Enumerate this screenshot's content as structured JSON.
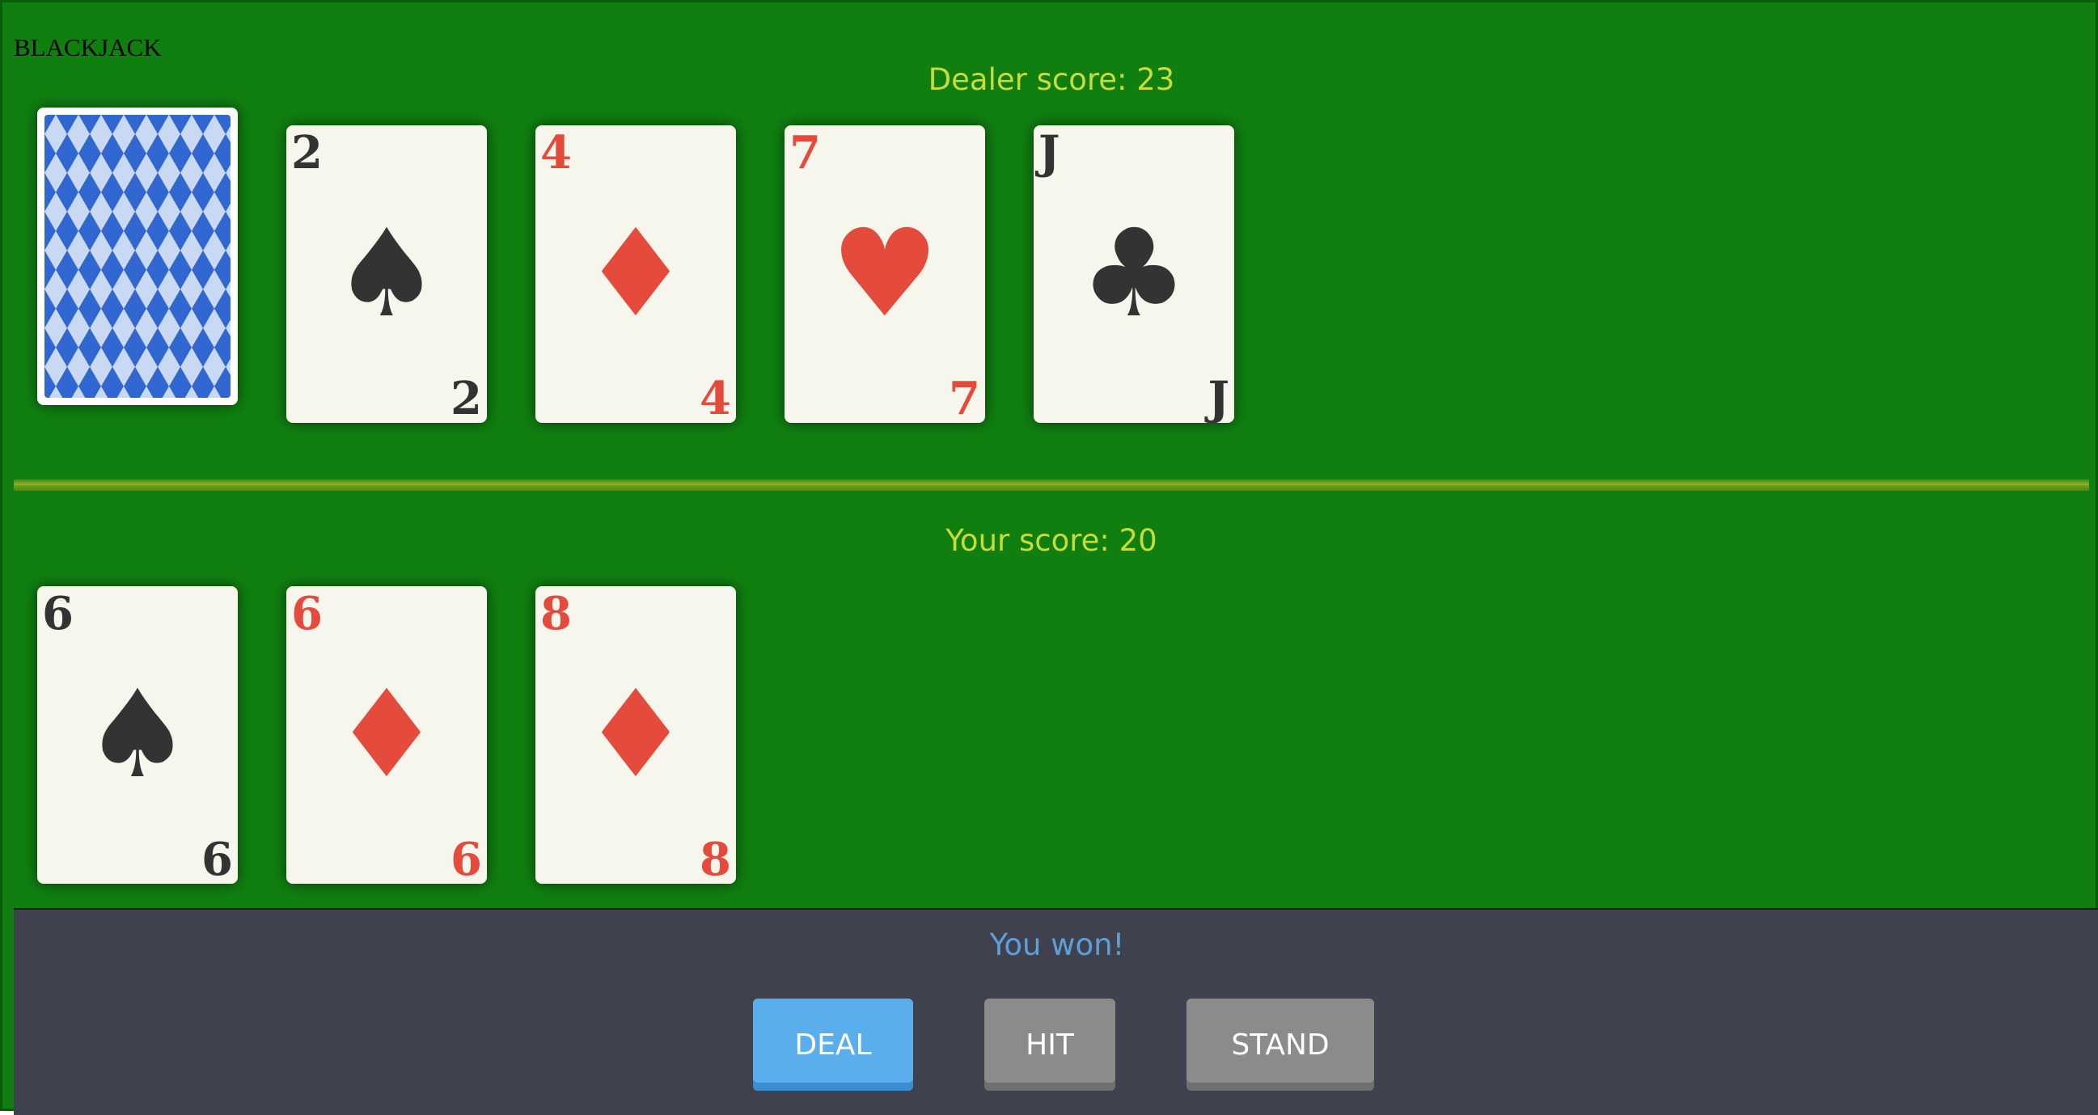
{
  "app": {
    "title": "BLACKJACK"
  },
  "dealer": {
    "score_label": "Dealer score: 23",
    "cards": [
      {
        "face_down": true
      },
      {
        "rank": "2",
        "suit": "♠",
        "color": "black"
      },
      {
        "rank": "4",
        "suit": "♦",
        "color": "red"
      },
      {
        "rank": "7",
        "suit": "♥",
        "color": "red"
      },
      {
        "rank": "J",
        "suit": "♣",
        "color": "black"
      }
    ]
  },
  "player": {
    "score_label": "Your score: 20",
    "cards": [
      {
        "rank": "6",
        "suit": "♠",
        "color": "black"
      },
      {
        "rank": "6",
        "suit": "♦",
        "color": "red"
      },
      {
        "rank": "8",
        "suit": "♦",
        "color": "red"
      }
    ]
  },
  "status": {
    "message": "You won!"
  },
  "controls": {
    "deal": "DEAL",
    "hit": "HIT",
    "stand": "STAND"
  },
  "colors": {
    "table": "#107f10",
    "score_text": "#c5dc3c",
    "red_suit": "#e54b3c",
    "black_suit": "#333333",
    "panel": "#3f424e",
    "status_text": "#5e9fd8",
    "deal_button": "#5aaeeb",
    "secondary_button": "#8b8b8b"
  }
}
